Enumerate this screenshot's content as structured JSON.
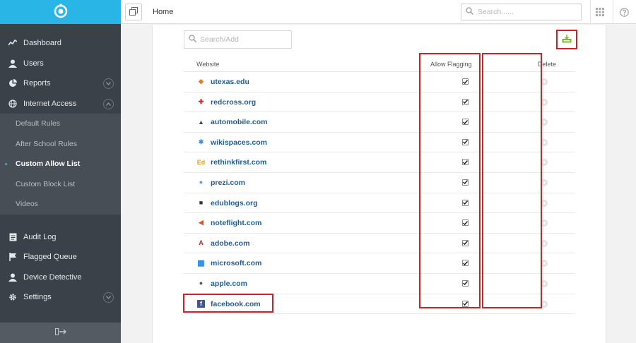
{
  "sidebar": {
    "nav": [
      {
        "label": "Dashboard",
        "icon": "dashboard-icon"
      },
      {
        "label": "Users",
        "icon": "user-icon"
      },
      {
        "label": "Reports",
        "icon": "pie-chart-icon"
      },
      {
        "label": "Internet Access",
        "icon": "globe-icon"
      }
    ],
    "submenu": [
      {
        "label": "Default Rules"
      },
      {
        "label": "After School Rules"
      },
      {
        "label": "Custom Allow List",
        "active": true
      },
      {
        "label": "Custom Block List"
      },
      {
        "label": "Videos"
      }
    ],
    "nav2": [
      {
        "label": "Audit Log",
        "icon": "log-icon"
      },
      {
        "label": "Flagged Queue",
        "icon": "flag-icon"
      },
      {
        "label": "Device Detective",
        "icon": "user-icon"
      },
      {
        "label": "Settings",
        "icon": "gear-icon"
      }
    ]
  },
  "header": {
    "title": "Home",
    "search_placeholder": "Search......"
  },
  "table": {
    "search_placeholder": "Search/Add",
    "columns": {
      "website": "Website",
      "allow_flagging": "Allow Flagging",
      "delete": "Delete"
    },
    "rows": [
      {
        "site": "utexas.edu",
        "favicon_color": "#e07b1a",
        "flagging": true
      },
      {
        "site": "redcross.org",
        "favicon_color": "#e02020",
        "flagging": true
      },
      {
        "site": "automobile.com",
        "favicon_color": "#1f4f9c",
        "flagging": true
      },
      {
        "site": "wikispaces.com",
        "favicon_color": "#3a8fd0",
        "flagging": true
      },
      {
        "site": "rethinkfirst.com",
        "favicon_color": "#e0a020",
        "flagging": true
      },
      {
        "site": "prezi.com",
        "favicon_color": "#4aa0e6",
        "flagging": true
      },
      {
        "site": "edublogs.org",
        "favicon_color": "#2b3a45",
        "flagging": true
      },
      {
        "site": "noteflight.com",
        "favicon_color": "#e0531f",
        "flagging": true
      },
      {
        "site": "adobe.com",
        "favicon_color": "#e01b1b",
        "flagging": true
      },
      {
        "site": "microsoft.com",
        "favicon_color": "#1e88e5",
        "flagging": true
      },
      {
        "site": "apple.com",
        "favicon_color": "#555555",
        "flagging": true
      },
      {
        "site": "facebook.com",
        "favicon_color": "#3b5998",
        "flagging": true
      }
    ]
  },
  "colors": {
    "accent": "#29b6e6",
    "sidebar": "#3b4148",
    "highlight": "#c0272d",
    "link": "#1f5d99",
    "download": "#7cb82f"
  }
}
